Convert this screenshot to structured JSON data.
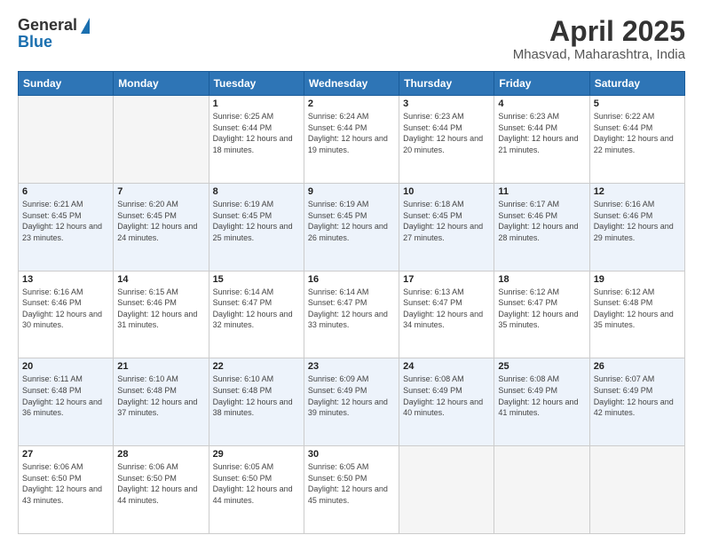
{
  "header": {
    "logo_general": "General",
    "logo_blue": "Blue",
    "month_title": "April 2025",
    "location": "Mhasvad, Maharashtra, India"
  },
  "days_of_week": [
    "Sunday",
    "Monday",
    "Tuesday",
    "Wednesday",
    "Thursday",
    "Friday",
    "Saturday"
  ],
  "weeks": [
    {
      "cells": [
        {
          "day": "",
          "sunrise": "",
          "sunset": "",
          "daylight": ""
        },
        {
          "day": "",
          "sunrise": "",
          "sunset": "",
          "daylight": ""
        },
        {
          "day": "1",
          "sunrise": "Sunrise: 6:25 AM",
          "sunset": "Sunset: 6:44 PM",
          "daylight": "Daylight: 12 hours and 18 minutes."
        },
        {
          "day": "2",
          "sunrise": "Sunrise: 6:24 AM",
          "sunset": "Sunset: 6:44 PM",
          "daylight": "Daylight: 12 hours and 19 minutes."
        },
        {
          "day": "3",
          "sunrise": "Sunrise: 6:23 AM",
          "sunset": "Sunset: 6:44 PM",
          "daylight": "Daylight: 12 hours and 20 minutes."
        },
        {
          "day": "4",
          "sunrise": "Sunrise: 6:23 AM",
          "sunset": "Sunset: 6:44 PM",
          "daylight": "Daylight: 12 hours and 21 minutes."
        },
        {
          "day": "5",
          "sunrise": "Sunrise: 6:22 AM",
          "sunset": "Sunset: 6:44 PM",
          "daylight": "Daylight: 12 hours and 22 minutes."
        }
      ]
    },
    {
      "cells": [
        {
          "day": "6",
          "sunrise": "Sunrise: 6:21 AM",
          "sunset": "Sunset: 6:45 PM",
          "daylight": "Daylight: 12 hours and 23 minutes."
        },
        {
          "day": "7",
          "sunrise": "Sunrise: 6:20 AM",
          "sunset": "Sunset: 6:45 PM",
          "daylight": "Daylight: 12 hours and 24 minutes."
        },
        {
          "day": "8",
          "sunrise": "Sunrise: 6:19 AM",
          "sunset": "Sunset: 6:45 PM",
          "daylight": "Daylight: 12 hours and 25 minutes."
        },
        {
          "day": "9",
          "sunrise": "Sunrise: 6:19 AM",
          "sunset": "Sunset: 6:45 PM",
          "daylight": "Daylight: 12 hours and 26 minutes."
        },
        {
          "day": "10",
          "sunrise": "Sunrise: 6:18 AM",
          "sunset": "Sunset: 6:45 PM",
          "daylight": "Daylight: 12 hours and 27 minutes."
        },
        {
          "day": "11",
          "sunrise": "Sunrise: 6:17 AM",
          "sunset": "Sunset: 6:46 PM",
          "daylight": "Daylight: 12 hours and 28 minutes."
        },
        {
          "day": "12",
          "sunrise": "Sunrise: 6:16 AM",
          "sunset": "Sunset: 6:46 PM",
          "daylight": "Daylight: 12 hours and 29 minutes."
        }
      ]
    },
    {
      "cells": [
        {
          "day": "13",
          "sunrise": "Sunrise: 6:16 AM",
          "sunset": "Sunset: 6:46 PM",
          "daylight": "Daylight: 12 hours and 30 minutes."
        },
        {
          "day": "14",
          "sunrise": "Sunrise: 6:15 AM",
          "sunset": "Sunset: 6:46 PM",
          "daylight": "Daylight: 12 hours and 31 minutes."
        },
        {
          "day": "15",
          "sunrise": "Sunrise: 6:14 AM",
          "sunset": "Sunset: 6:47 PM",
          "daylight": "Daylight: 12 hours and 32 minutes."
        },
        {
          "day": "16",
          "sunrise": "Sunrise: 6:14 AM",
          "sunset": "Sunset: 6:47 PM",
          "daylight": "Daylight: 12 hours and 33 minutes."
        },
        {
          "day": "17",
          "sunrise": "Sunrise: 6:13 AM",
          "sunset": "Sunset: 6:47 PM",
          "daylight": "Daylight: 12 hours and 34 minutes."
        },
        {
          "day": "18",
          "sunrise": "Sunrise: 6:12 AM",
          "sunset": "Sunset: 6:47 PM",
          "daylight": "Daylight: 12 hours and 35 minutes."
        },
        {
          "day": "19",
          "sunrise": "Sunrise: 6:12 AM",
          "sunset": "Sunset: 6:48 PM",
          "daylight": "Daylight: 12 hours and 35 minutes."
        }
      ]
    },
    {
      "cells": [
        {
          "day": "20",
          "sunrise": "Sunrise: 6:11 AM",
          "sunset": "Sunset: 6:48 PM",
          "daylight": "Daylight: 12 hours and 36 minutes."
        },
        {
          "day": "21",
          "sunrise": "Sunrise: 6:10 AM",
          "sunset": "Sunset: 6:48 PM",
          "daylight": "Daylight: 12 hours and 37 minutes."
        },
        {
          "day": "22",
          "sunrise": "Sunrise: 6:10 AM",
          "sunset": "Sunset: 6:48 PM",
          "daylight": "Daylight: 12 hours and 38 minutes."
        },
        {
          "day": "23",
          "sunrise": "Sunrise: 6:09 AM",
          "sunset": "Sunset: 6:49 PM",
          "daylight": "Daylight: 12 hours and 39 minutes."
        },
        {
          "day": "24",
          "sunrise": "Sunrise: 6:08 AM",
          "sunset": "Sunset: 6:49 PM",
          "daylight": "Daylight: 12 hours and 40 minutes."
        },
        {
          "day": "25",
          "sunrise": "Sunrise: 6:08 AM",
          "sunset": "Sunset: 6:49 PM",
          "daylight": "Daylight: 12 hours and 41 minutes."
        },
        {
          "day": "26",
          "sunrise": "Sunrise: 6:07 AM",
          "sunset": "Sunset: 6:49 PM",
          "daylight": "Daylight: 12 hours and 42 minutes."
        }
      ]
    },
    {
      "cells": [
        {
          "day": "27",
          "sunrise": "Sunrise: 6:06 AM",
          "sunset": "Sunset: 6:50 PM",
          "daylight": "Daylight: 12 hours and 43 minutes."
        },
        {
          "day": "28",
          "sunrise": "Sunrise: 6:06 AM",
          "sunset": "Sunset: 6:50 PM",
          "daylight": "Daylight: 12 hours and 44 minutes."
        },
        {
          "day": "29",
          "sunrise": "Sunrise: 6:05 AM",
          "sunset": "Sunset: 6:50 PM",
          "daylight": "Daylight: 12 hours and 44 minutes."
        },
        {
          "day": "30",
          "sunrise": "Sunrise: 6:05 AM",
          "sunset": "Sunset: 6:50 PM",
          "daylight": "Daylight: 12 hours and 45 minutes."
        },
        {
          "day": "",
          "sunrise": "",
          "sunset": "",
          "daylight": ""
        },
        {
          "day": "",
          "sunrise": "",
          "sunset": "",
          "daylight": ""
        },
        {
          "day": "",
          "sunrise": "",
          "sunset": "",
          "daylight": ""
        }
      ]
    }
  ]
}
